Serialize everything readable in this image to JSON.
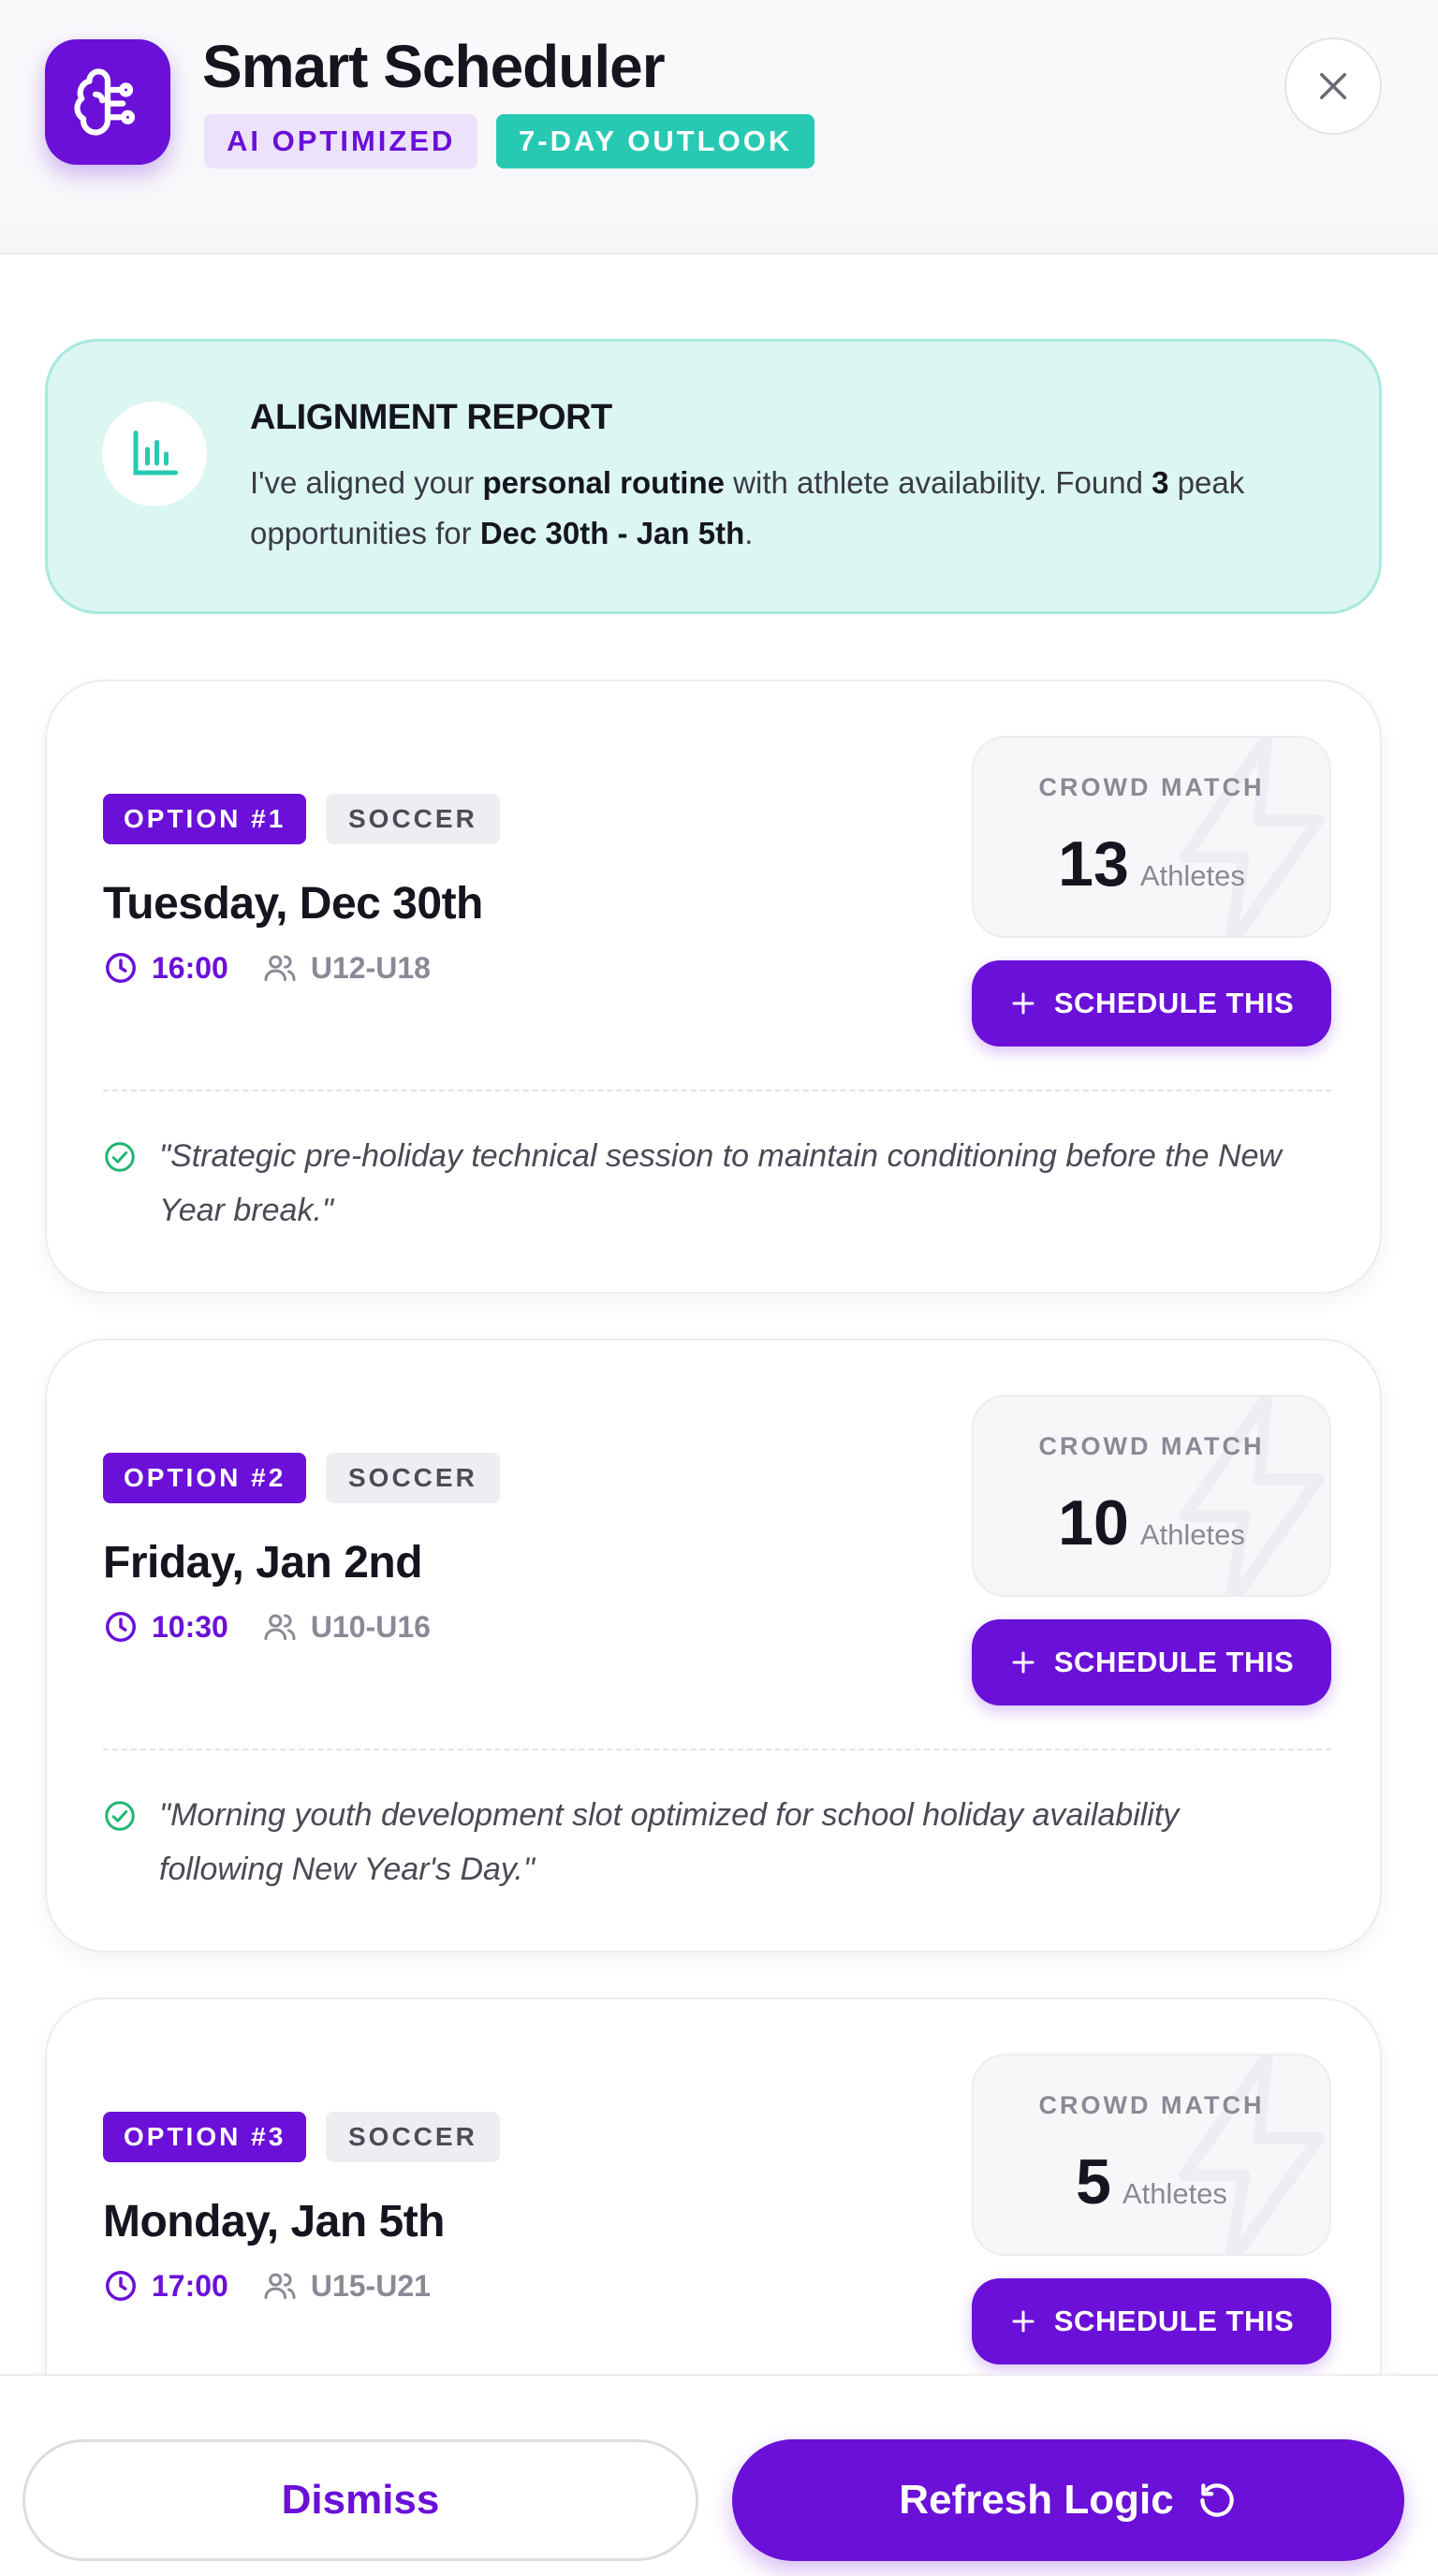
{
  "header": {
    "title": "Smart Scheduler",
    "badges": [
      "AI OPTIMIZED",
      "7-DAY OUTLOOK"
    ],
    "app_icon": "brain-icon",
    "close_icon": "close-icon"
  },
  "report": {
    "icon": "bar-chart-icon",
    "title": "ALIGNMENT REPORT",
    "text_1": "I've aligned your ",
    "text_bold_1": "personal routine",
    "text_2": " with athlete availability. Found ",
    "text_bold_2": "3",
    "text_3": " peak opportunities for ",
    "text_bold_3": "Dec 30th - Jan 5th",
    "text_4": "."
  },
  "options": [
    {
      "label": "OPTION #1",
      "sport": "SOCCER",
      "date": "Tuesday, Dec 30th",
      "time": "16:00",
      "ages": "U12-U18",
      "crowd_label": "CROWD MATCH",
      "crowd_count": "13",
      "crowd_unit": "Athletes",
      "button": "SCHEDULE THIS",
      "rationale": "\"Strategic pre-holiday technical session to maintain conditioning before the New Year break.\""
    },
    {
      "label": "OPTION #2",
      "sport": "SOCCER",
      "date": "Friday, Jan 2nd",
      "time": "10:30",
      "ages": "U10-U16",
      "crowd_label": "CROWD MATCH",
      "crowd_count": "10",
      "crowd_unit": "Athletes",
      "button": "SCHEDULE THIS",
      "rationale": "\"Morning youth development slot optimized for school holiday availability following New Year's Day.\""
    },
    {
      "label": "OPTION #3",
      "sport": "SOCCER",
      "date": "Monday, Jan 5th",
      "time": "17:00",
      "ages": "U15-U21",
      "crowd_label": "CROWD MATCH",
      "crowd_count": "5",
      "crowd_unit": "Athletes",
      "button": "SCHEDULE THIS"
    }
  ],
  "footer": {
    "dismiss": "Dismiss",
    "refresh": "Refresh Logic",
    "refresh_icon": "refresh-icon"
  },
  "colors": {
    "accent": "#6a10d8",
    "teal": "#27c9b2",
    "report_bg": "#dcf6f2",
    "success": "#22b573"
  }
}
